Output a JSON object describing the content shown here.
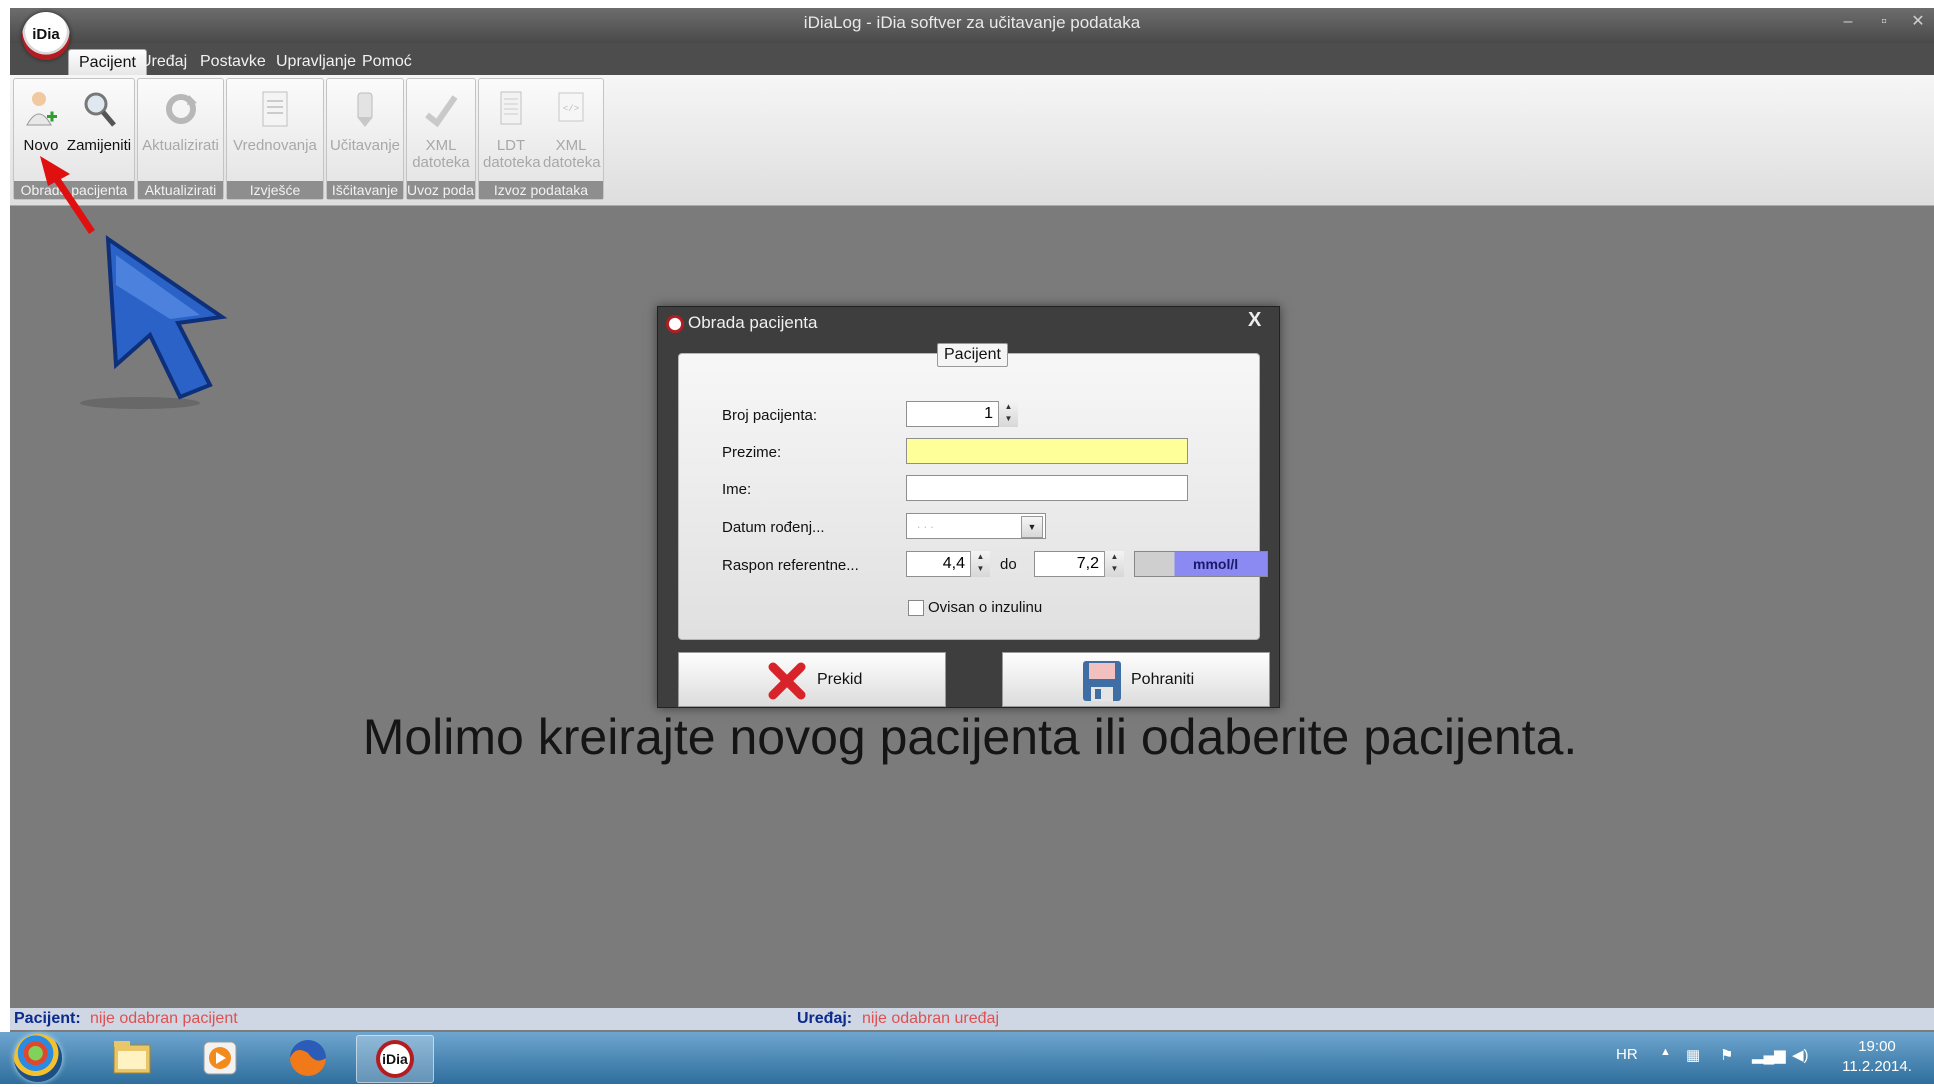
{
  "window": {
    "title": "iDiaLog - iDia softver za učitavanje podataka",
    "app_logo": "iDia"
  },
  "menu": {
    "items": [
      {
        "label": "Pacijent",
        "active": true
      },
      {
        "label": "Uređaj",
        "active": false
      },
      {
        "label": "Postavke",
        "active": false
      },
      {
        "label": "Upravljanje",
        "active": false
      },
      {
        "label": "Pomoć",
        "active": false
      }
    ]
  },
  "ribbon": {
    "groups": [
      {
        "label": "Obrada pacijenta",
        "buttons": [
          {
            "label": "Novo",
            "icon": "new-patient-icon",
            "enabled": true
          },
          {
            "label": "Zamijeniti",
            "icon": "search-icon",
            "enabled": true
          }
        ]
      },
      {
        "label": "Aktualizirati",
        "buttons": [
          {
            "label": "Aktualizirati",
            "icon": "refresh-icon",
            "enabled": false
          }
        ]
      },
      {
        "label": "Izvješće",
        "buttons": [
          {
            "label": "Vrednovanja",
            "icon": "report-icon",
            "enabled": false
          }
        ]
      },
      {
        "label": "Iščitavanje",
        "buttons": [
          {
            "label": "Učitavanje",
            "icon": "read-device-icon",
            "enabled": false
          }
        ]
      },
      {
        "label": "Uvoz poda...",
        "buttons": [
          {
            "label": "XML datoteka",
            "icon": "xml-import-icon",
            "enabled": false
          }
        ]
      },
      {
        "label": "Izvoz podataka",
        "buttons": [
          {
            "label": "LDT datoteka",
            "icon": "ldt-export-icon",
            "enabled": false
          },
          {
            "label": "XML datoteka",
            "icon": "xml-export-icon",
            "enabled": false
          }
        ]
      }
    ]
  },
  "main": {
    "message": "Molimo kreirajte novog pacijenta ili odaberite pacijenta."
  },
  "dialog": {
    "title": "Obrada pacijenta",
    "close_label": "X",
    "tab": "Pacijent",
    "fields": {
      "patient_no_label": "Broj pacijenta:",
      "patient_no_value": "1",
      "surname_label": "Prezime:",
      "surname_value": "",
      "name_label": "Ime:",
      "name_value": "",
      "dob_label": "Datum rođenj...",
      "dob_value": ". . .",
      "range_label": "Raspon referentne...",
      "range_from": "4,4",
      "range_to_label": "do",
      "range_to": "7,2",
      "unit_label": "mmol/l",
      "insulin_label": "Ovisan o inzulinu",
      "insulin_checked": false
    },
    "cancel_label": "Prekid",
    "save_label": "Pohraniti"
  },
  "status_bar": {
    "patient_label": "Pacijent:",
    "patient_value": "nije odabran pacijent",
    "device_label": "Uređaj:",
    "device_value": "nije odabran uređaj"
  },
  "taskbar": {
    "pinned": [
      "start-orb",
      "file-explorer-icon",
      "media-player-icon",
      "firefox-icon",
      "idia-app-icon"
    ],
    "language": "HR",
    "time": "19:00",
    "date": "11.2.2014."
  },
  "colors": {
    "highlight_field": "#ffff99",
    "status_label": "#0b2a8c",
    "status_value": "#e05050",
    "unit_button": "#7f7ff0"
  }
}
